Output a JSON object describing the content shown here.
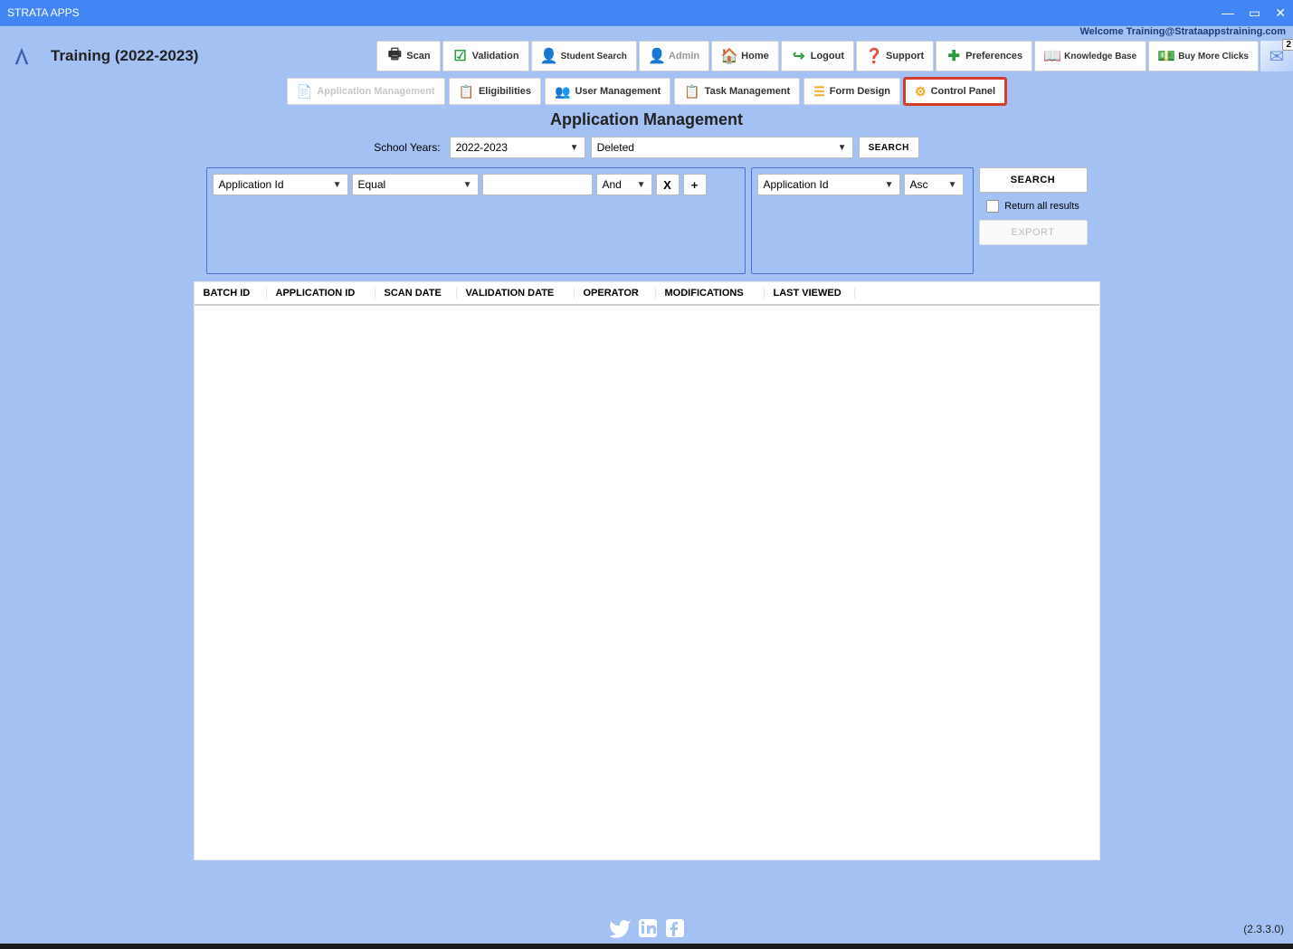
{
  "titlebar": {
    "app_name": "STRATA APPS"
  },
  "welcome_text": "Welcome Training@Strataappstraining.com",
  "page_title": "Training (2022-2023)",
  "topnav": {
    "scan": "Scan",
    "validation": "Validation",
    "student_search": "Student Search",
    "admin": "Admin",
    "home": "Home",
    "logout": "Logout",
    "support": "Support",
    "preferences": "Preferences",
    "knowledge_base": "Knowledge Base",
    "buy_more_clicks": "Buy More Clicks",
    "notification_count": "2"
  },
  "subnav": {
    "app_mgmt": "Application Management",
    "eligibilities": "Eligibilities",
    "user_mgmt": "User Management",
    "task_mgmt": "Task Management",
    "form_design": "Form Design",
    "control_panel": "Control Panel"
  },
  "heading": "Application Management",
  "filter": {
    "label": "School Years:",
    "year": "2022-2023",
    "status": "Deleted",
    "search_btn": "SEARCH"
  },
  "query": {
    "field": "Application Id",
    "op": "Equal",
    "logic": "And",
    "sort_field": "Application Id",
    "sort_dir": "Asc",
    "search_btn": "SEARCH",
    "return_all": "Return all results",
    "export_btn": "EXPORT"
  },
  "columns": {
    "batch_id": "BATCH ID",
    "app_id": "APPLICATION ID",
    "scan_date": "SCAN DATE",
    "val_date": "VALIDATION DATE",
    "operator": "OPERATOR",
    "mods": "MODIFICATIONS",
    "last_viewed": "LAST VIEWED"
  },
  "version": "(2.3.3.0)"
}
